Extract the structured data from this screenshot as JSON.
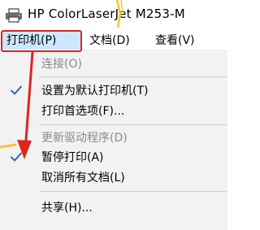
{
  "window": {
    "title": "HP ColorLaserJet M253-M",
    "icon": "printer-icon"
  },
  "menubar": {
    "printer": "打印机(P)",
    "document": "文档(D)",
    "view": "查看(V)"
  },
  "menu": {
    "connect": "连接(O)",
    "set_default": "设置为默认打印机(T)",
    "preferences": "打印首选项(F)...",
    "update_driver": "更新驱动程序(D)",
    "pause_printing": "暂停打印(A)",
    "cancel_all": "取消所有文档(L)",
    "share": "共享(H)..."
  },
  "colors": {
    "highlight": "#e0241b",
    "check": "#1a5fb4",
    "menu_selected": "#cce8ff",
    "glare": "#f6c33a"
  }
}
